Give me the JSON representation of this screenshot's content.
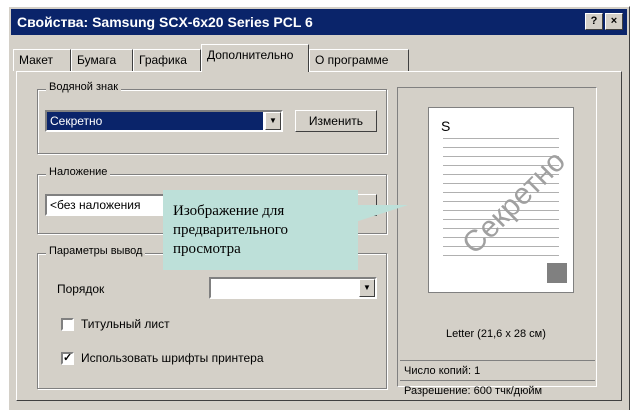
{
  "window": {
    "title": "Свойства: Samsung SCX-6x20 Series PCL 6",
    "help_btn": "?",
    "close_btn": "×"
  },
  "tabs": [
    {
      "label": "Макет"
    },
    {
      "label": "Бумага"
    },
    {
      "label": "Графика"
    },
    {
      "label": "Дополнительно"
    },
    {
      "label": "О программе"
    }
  ],
  "watermark": {
    "group_label": "Водяной знак",
    "value": "Секретно",
    "edit_button": "Изменить"
  },
  "overlay": {
    "group_label": "Наложение",
    "value": "<без наложения"
  },
  "output": {
    "group_label": "Параметры вывод",
    "order_label": "Порядок",
    "cover_page_label": "Титульный лист",
    "cover_page_checked": false,
    "printer_fonts_label": "Использовать шрифты принтера",
    "printer_fonts_checked": true,
    "check_mark": "✓"
  },
  "preview": {
    "paper_letter": "S",
    "watermark_text": "Секретно",
    "paper_size": "Letter (21,6 x 28 см)",
    "copies": "Число копий: 1",
    "resolution": "Разрешение: 600 тчк/дюйм"
  },
  "callout": {
    "text_lines": [
      "Изображение для",
      "предварительного",
      "просмотра"
    ]
  },
  "colors": {
    "titlebar": "#0a246a",
    "dialog_bg": "#d4d0c8",
    "callout_bg": "#bde0d9",
    "watermark_text": "#a0a0a0",
    "paper_square": "#808080"
  },
  "icons": {
    "dropdown": "▼"
  }
}
